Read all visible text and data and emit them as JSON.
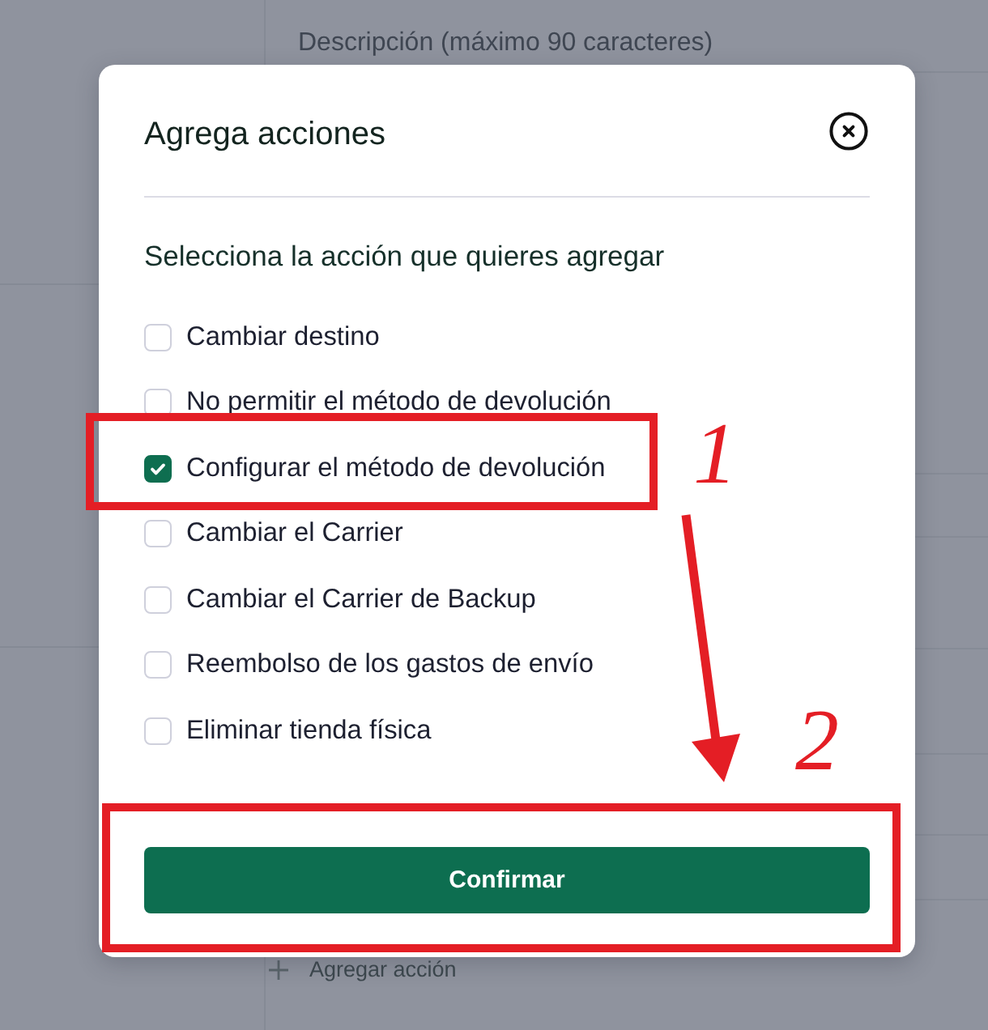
{
  "background": {
    "description_label": "Descripción (máximo 90 caracteres)",
    "add_action_button": "Agregar acción"
  },
  "dialog": {
    "title": "Agrega acciones",
    "prompt": "Selecciona la acción que quieres agregar",
    "actions": [
      {
        "label": "Cambiar destino",
        "checked": false
      },
      {
        "label": "No permitir el método de devolución",
        "checked": false
      },
      {
        "label": "Configurar el método de devolución",
        "checked": true
      },
      {
        "label": "Cambiar el Carrier",
        "checked": false
      },
      {
        "label": "Cambiar el Carrier de Backup",
        "checked": false
      },
      {
        "label": "Reembolso de los gastos de envío",
        "checked": false
      },
      {
        "label": "Eliminar tienda física",
        "checked": false
      }
    ],
    "confirm_button": "Confirmar"
  },
  "annotations": [
    {
      "kind": "row-highlight",
      "label": "1"
    },
    {
      "kind": "arrow"
    },
    {
      "kind": "footer-highlight",
      "label": "2"
    }
  ]
}
